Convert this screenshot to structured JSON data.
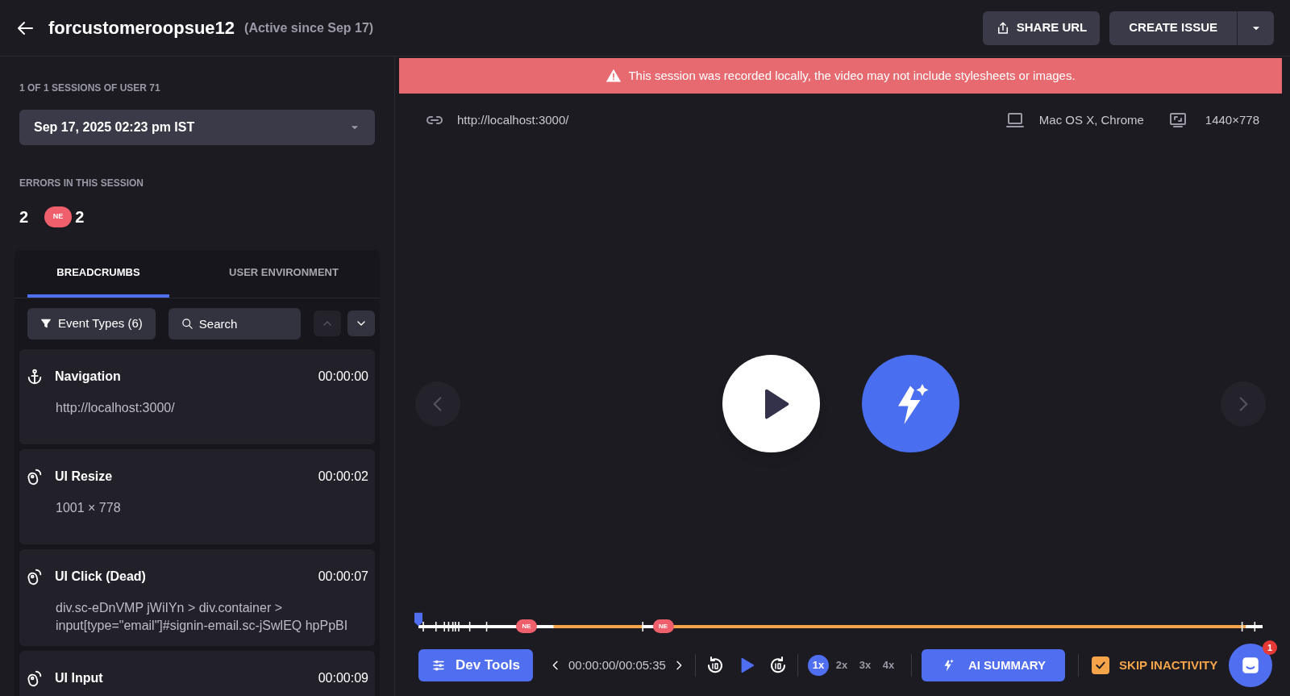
{
  "header": {
    "title": "forcustomeroopsue12",
    "subtitle": "(Active since Sep 17)",
    "buttons": [
      {
        "kind": "share",
        "label": "SHARE URL"
      },
      {
        "kind": "primary",
        "label": "CREATE ISSUE"
      }
    ]
  },
  "sidebar": {
    "sessions_label": "1 OF 1 SESSIONS OF USER 71",
    "session_select": "Sep 17, 2025 02:23 pm IST",
    "errors_label": "ERRORS IN THIS SESSION",
    "errors_total": "2",
    "error_badges": [
      {
        "label": "NE",
        "count": "2"
      }
    ],
    "tabs": [
      {
        "label": "BREADCRUMBS",
        "selected": true
      },
      {
        "label": "USER ENVIRONMENT",
        "selected": false
      }
    ],
    "filter_button": "Event Types (6)",
    "search": {
      "placeholder": "Search"
    },
    "nav_buttons": [
      {
        "kind": "up",
        "disabled": true
      },
      {
        "kind": "down",
        "disabled": false
      }
    ],
    "events": [
      {
        "kind": "navigation",
        "title": "Navigation",
        "time": "00:00:00",
        "detail": "http://localhost:3000/"
      },
      {
        "kind": "ui",
        "title": "UI Resize",
        "time": "00:00:02",
        "detail": "1001 × 778"
      },
      {
        "kind": "ui",
        "title": "UI Click (Dead)",
        "time": "00:00:07",
        "detail": "div.sc-eDnVMP jWiIYn > div.container > input[type=\"email\"]#signin-email.sc-jSwlEQ hpPpBI"
      },
      {
        "kind": "ui",
        "title": "UI Input",
        "time": "00:00:09"
      }
    ]
  },
  "player": {
    "banner": "This session was recorded locally, the video may not include stylesheets or images.",
    "url": "http://localhost:3000/",
    "platform": "Mac OS X, Chrome",
    "resolution": "1440×778",
    "timeline": {
      "markers": [
        {
          "label": "NE"
        },
        {
          "label": "NE"
        }
      ]
    },
    "time": "00:00:00/00:05:35",
    "speeds": [
      {
        "label": "1x",
        "selected": true
      },
      {
        "label": "2x",
        "selected": false
      },
      {
        "label": "3x",
        "selected": false
      },
      {
        "label": "4x",
        "selected": false
      }
    ],
    "dev_tools": "Dev Tools",
    "ai_summary": "AI SUMMARY",
    "skip_inactivity": {
      "label": "SKIP INACTIVITY",
      "checked": true
    },
    "chat_badge": "1"
  }
}
